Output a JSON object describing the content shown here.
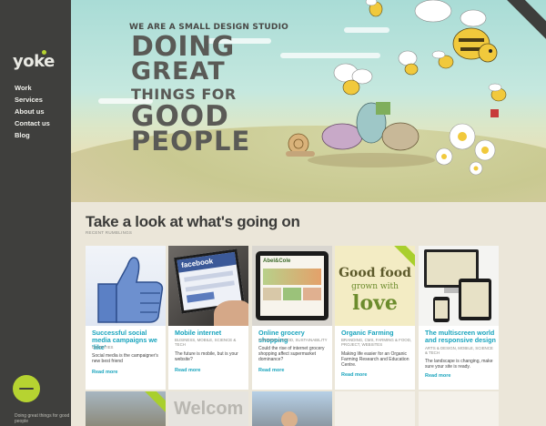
{
  "sidebar": {
    "logo": "yoke",
    "nav": [
      "Work",
      "Services",
      "About us",
      "Contact us",
      "Blog"
    ],
    "tagline": "Doing great things for good people"
  },
  "hero": {
    "subtitle": "WE ARE A SMALL DESIGN STUDIO",
    "line1": "DOING",
    "line2": "GREAT",
    "line3": "THINGS FOR",
    "line4": "GOOD",
    "line5": "PEOPLE"
  },
  "section": {
    "title": "Take a look at what's going on",
    "subtitle": "RECENT RUMBLINGS"
  },
  "cards": [
    {
      "title": "Successful social media campaigns we 'like'",
      "category": "CHARITIES",
      "desc": "Social media is the campaigner's new best friend",
      "more": "Read more"
    },
    {
      "title": "Mobile internet",
      "category": "BUSINESS, MOBILE, SCIENCE & TECH",
      "desc": "The future is mobile, but is your website?",
      "more": "Read more"
    },
    {
      "title": "Online grocery shopping",
      "category": "FARMING & FOOD, SUSTAINABILITY",
      "desc": "Could the rise of internet grocery shopping affect supermarket dominance?",
      "more": "Read more"
    },
    {
      "title": "Organic Farming",
      "category": "BRANDING, CMS, FARMING & FOOD, PROJECT, WEBSITES",
      "desc": "Making life easier for an Organic Farming Research and Education Centre.",
      "more": "Read more"
    },
    {
      "title": "The multiscreen world and responsive design",
      "category": "ARTS & DESIGN, MOBILE, SCIENCE & TECH",
      "desc": "The landscape is changing, make sure your site is ready.",
      "more": "Read more"
    }
  ],
  "thumbs": {
    "facebook": "facebook",
    "good_food_1": "Good food",
    "good_food_2": "grown with",
    "good_food_3": "love",
    "abel": "Abel&Cole",
    "welcome": "Welcom"
  },
  "colors": {
    "sidebar": "#3f3f3d",
    "accent": "#b6d331",
    "link": "#19a4bd"
  }
}
